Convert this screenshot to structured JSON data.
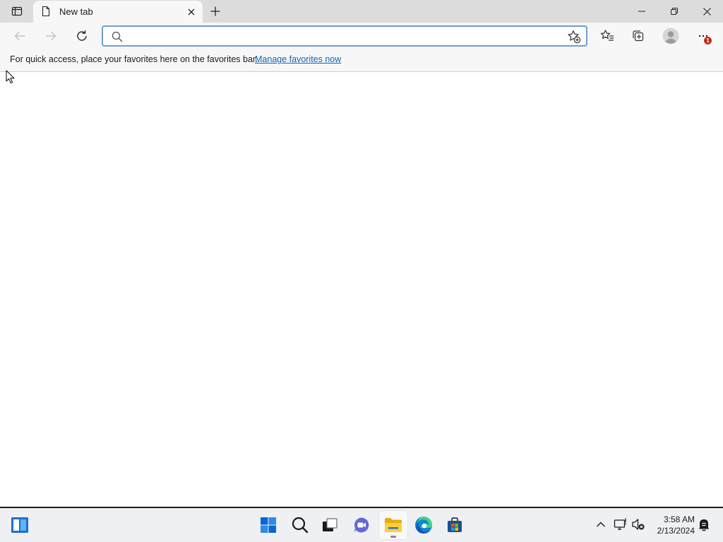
{
  "browser": {
    "tabs": [
      {
        "title": "New tab",
        "active": true
      }
    ],
    "address_bar": {
      "value": "",
      "placeholder": ""
    },
    "notification_badge": "1",
    "favorites_bar": {
      "message": "For quick access, place your favorites here on the favorites bar.",
      "link": "Manage favorites now"
    },
    "colors": {
      "tabstrip": "#dcdcdc",
      "toolbar": "#f7f7f7",
      "address_border": "#6f9ecf",
      "link": "#0f63b4",
      "badge": "#c42b1c"
    }
  },
  "taskbar": {
    "apps": [
      {
        "name": "Start",
        "icon": "windows-start-icon"
      },
      {
        "name": "Search",
        "icon": "search-icon"
      },
      {
        "name": "Task View",
        "icon": "task-view-icon"
      },
      {
        "name": "Chat",
        "icon": "chat-icon"
      },
      {
        "name": "File Explorer",
        "icon": "folder-icon",
        "active": true
      },
      {
        "name": "Microsoft Edge",
        "icon": "edge-icon"
      },
      {
        "name": "Microsoft Store",
        "icon": "store-icon"
      }
    ],
    "widgets_icon": "widgets-icon",
    "tray_icons": [
      "chevron-up-icon",
      "network-icon",
      "volume-muted-icon"
    ],
    "clock": {
      "time": "3:58 AM",
      "date": "2/13/2024"
    },
    "notifications_icon": "notification-icon"
  }
}
